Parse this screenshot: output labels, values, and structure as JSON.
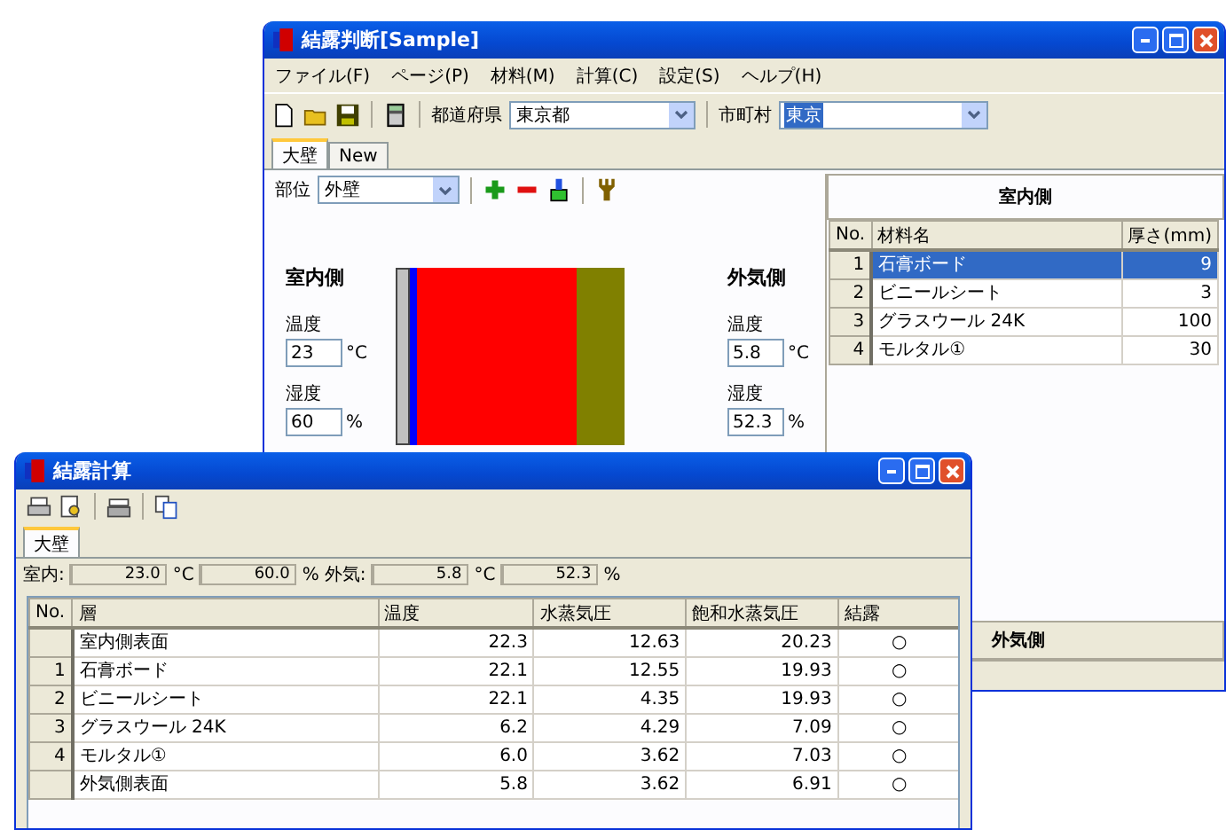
{
  "main_window": {
    "title": "結露判断[Sample]",
    "menu": [
      "ファイル(F)",
      "ページ(P)",
      "材料(M)",
      "計算(C)",
      "設定(S)",
      "ヘルプ(H)"
    ],
    "toolbar": {
      "prefecture_label": "都道府県",
      "prefecture": "東京都",
      "city_label": "市町村",
      "city": "東京"
    },
    "tabs": [
      {
        "label": "大壁",
        "selected": true
      },
      {
        "label": "New",
        "selected": false
      }
    ],
    "part": {
      "label": "部位",
      "value": "外壁"
    },
    "indoor": {
      "heading": "室内側",
      "temp_label": "温度",
      "temp": "23",
      "temp_unit": "°C",
      "humidity_label": "湿度",
      "humidity": "60",
      "humidity_unit": "%"
    },
    "outdoor": {
      "heading": "外気側",
      "temp_label": "温度",
      "temp": "5.8",
      "temp_unit": "°C",
      "humidity_label": "湿度",
      "humidity": "52.3",
      "humidity_unit": "%"
    },
    "layers_table": {
      "heading": "室内側",
      "columns": [
        "No.",
        "材料名",
        "厚さ(mm)"
      ],
      "rows": [
        {
          "no": "1",
          "name": "石膏ボード",
          "thickness": "9",
          "color": "#c0c0c0",
          "selected": true
        },
        {
          "no": "2",
          "name": "ビニールシート",
          "thickness": "3",
          "color": "#0000ff",
          "selected": false
        },
        {
          "no": "3",
          "name": "グラスウール 24K",
          "thickness": "100",
          "color": "#ff0000",
          "selected": false
        },
        {
          "no": "4",
          "name": "モルタル①",
          "thickness": "30",
          "color": "#808000",
          "selected": false
        }
      ],
      "footer": "外気側"
    }
  },
  "calc_window": {
    "title": "結露計算",
    "tabs": [
      {
        "label": "大壁",
        "selected": true
      }
    ],
    "indoor": {
      "label": "室内:",
      "temp": "23.0",
      "temp_unit": "°C",
      "humidity": "60.0",
      "humidity_unit": "%"
    },
    "outdoor": {
      "label": "外気:",
      "temp": "5.8",
      "temp_unit": "°C",
      "humidity": "52.3",
      "humidity_unit": "%"
    },
    "table": {
      "columns": [
        "No.",
        "層",
        "温度",
        "水蒸気圧",
        "飽和水蒸気圧",
        "結露"
      ],
      "rows": [
        {
          "layer": "室内側表面",
          "temperature": "22.3",
          "vapor_pressure": "12.63",
          "saturated_vapor_pressure": "20.23",
          "condensation": "○"
        },
        {
          "no": "1",
          "layer": "石膏ボード",
          "temperature": "22.1",
          "vapor_pressure": "12.55",
          "saturated_vapor_pressure": "19.93",
          "condensation": "○"
        },
        {
          "no": "2",
          "layer": "ビニールシート",
          "temperature": "22.1",
          "vapor_pressure": "4.35",
          "saturated_vapor_pressure": "19.93",
          "condensation": "○"
        },
        {
          "no": "3",
          "layer": "グラスウール 24K",
          "temperature": "6.2",
          "vapor_pressure": "4.29",
          "saturated_vapor_pressure": "7.09",
          "condensation": "○"
        },
        {
          "no": "4",
          "layer": "モルタル①",
          "temperature": "6.0",
          "vapor_pressure": "3.62",
          "saturated_vapor_pressure": "7.03",
          "condensation": "○"
        },
        {
          "layer": "外気側表面",
          "temperature": "5.8",
          "vapor_pressure": "3.62",
          "saturated_vapor_pressure": "6.91",
          "condensation": "○"
        }
      ]
    }
  }
}
